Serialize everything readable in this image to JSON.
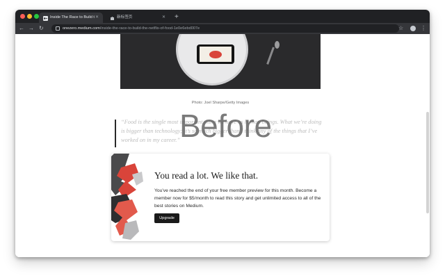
{
  "browser": {
    "tabs": [
      {
        "label": "Inside The Race to Build the 'Ne",
        "active": true
      },
      {
        "label": "新标签页",
        "active": false
      }
    ],
    "new_tab_icon": "plus-icon",
    "url": {
      "domain": "onezero.medium.com",
      "path": "/inside-the-race-to-build-the-netflix-of-food-1e0e6ebd007e"
    }
  },
  "article": {
    "photo_caption": "Photo: Joel Sharpe/Getty Images",
    "quote": "“Food is the single most important thing we have as human beings. What we’re doing is bigger than technology; it’s so much bigger than I think any of the things that I’ve worked on in my career.”",
    "overlay_text": "Before"
  },
  "paywall": {
    "title": "You read a lot. We like that.",
    "body": "You’ve reached the end of your free member preview for this month. Become a member now for $5/month to read this story and get unlimited access to all of the best stories on Medium.",
    "button_label": "Upgrade"
  },
  "colors": {
    "titlebar": "#202124",
    "toolbar": "#35363a",
    "accent_red": "#d9443a",
    "button": "#1a1a1a"
  }
}
